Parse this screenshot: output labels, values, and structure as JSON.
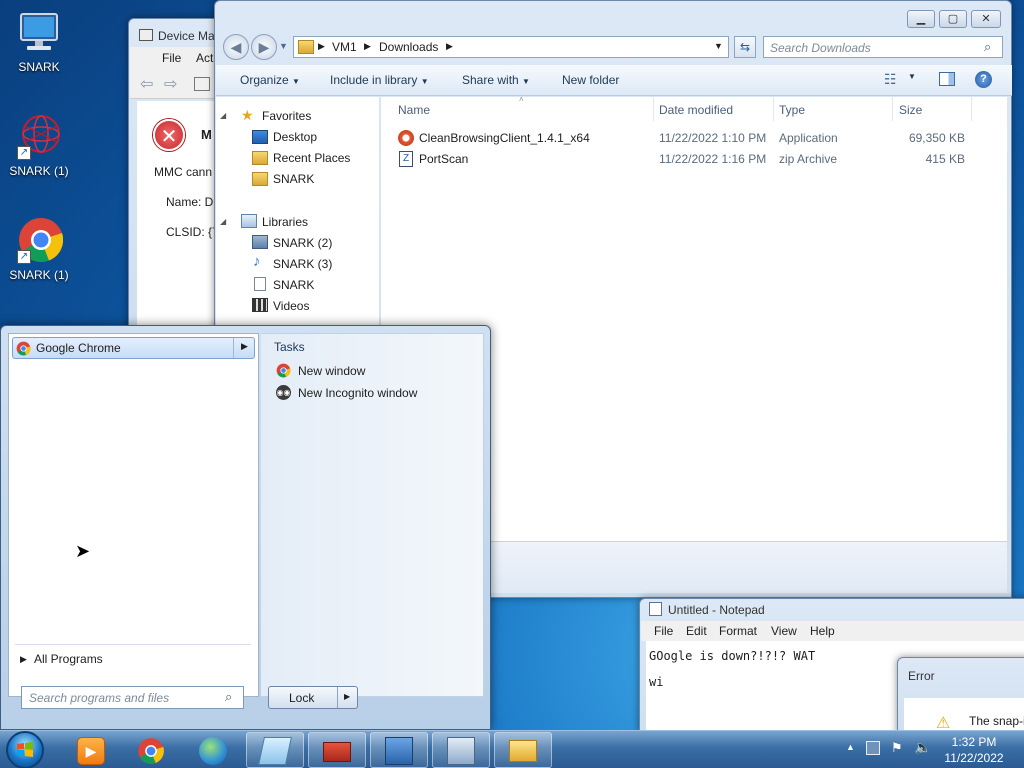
{
  "desktop": {
    "icons": [
      {
        "label": "SNARK"
      },
      {
        "label": "SNARK (1)"
      },
      {
        "label": "SNARK (1)"
      }
    ]
  },
  "device_manager": {
    "title": "Device Ma",
    "menu": [
      "File",
      "Act"
    ],
    "error_heading": "M",
    "message": "MMC cann",
    "name_line": "Name: D",
    "clsid_line": "CLSID: {7"
  },
  "explorer": {
    "breadcrumb": [
      "VM1",
      "Downloads"
    ],
    "search_placeholder": "Search Downloads",
    "toolbar": {
      "organize": "Organize",
      "include_in_library": "Include in library",
      "share_with": "Share with",
      "new_folder": "New folder"
    },
    "nav": {
      "favorites_header": "Favorites",
      "favorites": [
        "Desktop",
        "Recent Places",
        "SNARK"
      ],
      "libraries_header": "Libraries",
      "libraries": [
        "SNARK (2)",
        "SNARK (3)",
        "SNARK",
        "Videos"
      ]
    },
    "columns": {
      "name": "Name",
      "date_modified": "Date modified",
      "type": "Type",
      "size": "Size"
    },
    "files": [
      {
        "name": "CleanBrowsingClient_1.4.1_x64",
        "date": "11/22/2022 1:10 PM",
        "type": "Application",
        "size": "69,350 KB"
      },
      {
        "name": "PortScan",
        "date": "11/22/2022 1:16 PM",
        "type": "zip Archive",
        "size": "415 KB"
      }
    ]
  },
  "start_menu": {
    "pinned_program": "Google Chrome",
    "tasks_header": "Tasks",
    "tasks": [
      "New window",
      "New Incognito window"
    ],
    "all_programs": "All Programs",
    "search_placeholder": "Search programs and files",
    "lock_label": "Lock"
  },
  "notepad": {
    "title": "Untitled - Notepad",
    "menu": [
      "File",
      "Edit",
      "Format",
      "View",
      "Help"
    ],
    "text_line1": "GOogle is down?!?!? WAT",
    "text_line2": "wi"
  },
  "error_dialog": {
    "title": "Error",
    "message": "The snap-i"
  },
  "taskbar": {
    "time": "1:32 PM",
    "date": "11/22/2022"
  },
  "colors": {
    "accent": "#1b79c7",
    "error_red": "#c8282e",
    "chrome_red": "#db4437",
    "chrome_yellow": "#f4c20d",
    "chrome_green": "#0f9d58",
    "chrome_blue": "#4285f4"
  }
}
